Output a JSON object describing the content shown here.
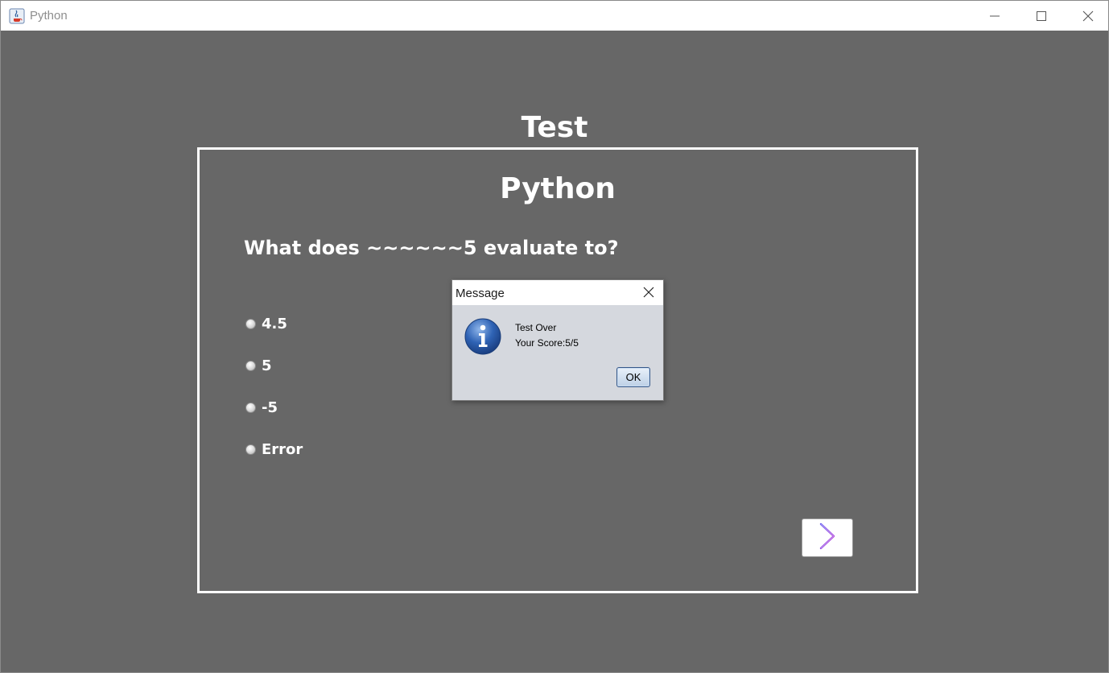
{
  "window": {
    "title": "Python",
    "controls": [
      "minimize-icon",
      "maximize-icon",
      "close-icon"
    ]
  },
  "header": {
    "title": "Test"
  },
  "quiz": {
    "subject": "Python",
    "question": "What does ~~~~~~5 evaluate to?",
    "options": [
      {
        "label": "4.5",
        "selected": false
      },
      {
        "label": "5",
        "selected": false
      },
      {
        "label": "-5",
        "selected": false
      },
      {
        "label": "Error",
        "selected": false
      }
    ],
    "next_icon": "chevron-right-icon"
  },
  "dialog": {
    "title": "Message",
    "icon": "info-icon",
    "line1": "Test Over",
    "line2": "Your Score:5/5",
    "ok_label": "OK"
  },
  "colors": {
    "background": "#676767",
    "panel_border": "#ffffff",
    "text": "#ffffff",
    "info_blue": "#2a5aa8",
    "chevron": "#8a4fd6"
  }
}
